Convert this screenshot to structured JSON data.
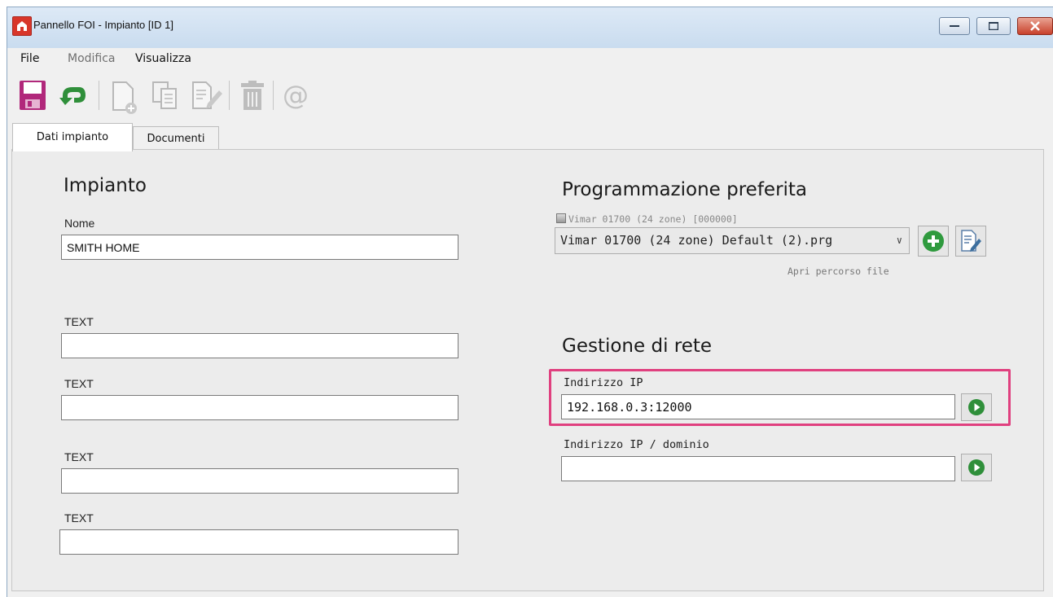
{
  "window": {
    "title": "Pannello FOI - Impianto [ID 1]",
    "controls": [
      "minimize",
      "maximize",
      "close"
    ]
  },
  "menu": [
    {
      "label": "File",
      "enabled": true
    },
    {
      "label": "Modifica",
      "enabled": false
    },
    {
      "label": "Visualizza",
      "enabled": true
    }
  ],
  "toolbar": {
    "icons": [
      "save-icon",
      "undo-icon",
      "new-document-icon",
      "copy-document-icon",
      "edit-document-icon",
      "delete-icon",
      "email-icon"
    ]
  },
  "tabs": [
    {
      "label": "Dati impianto",
      "active": true
    },
    {
      "label": "Documenti",
      "active": false
    }
  ],
  "impianto": {
    "heading": "Impianto",
    "nome_label": "Nome",
    "nome_value": "SMITH HOME",
    "text_fields": [
      {
        "label": "TEXT",
        "value": ""
      },
      {
        "label": "TEXT",
        "value": ""
      },
      {
        "label": "TEXT",
        "value": ""
      },
      {
        "label": "TEXT",
        "value": ""
      }
    ]
  },
  "programmazione": {
    "heading": "Programmazione preferita",
    "device_info": "Vimar 01700 (24 zone) [000000]",
    "selected_file": "Vimar 01700 (24 zone) Default (2).prg",
    "open_path_link": "Apri percorso file"
  },
  "rete": {
    "heading": "Gestione di rete",
    "ip_label": "Indirizzo IP",
    "ip_value": "192.168.0.3:12000",
    "domain_label": "Indirizzo IP / dominio",
    "domain_value": ""
  },
  "colors": {
    "highlight": "#e0407f",
    "accent_green": "#2f8f3a",
    "title_bar": "#c9dcef"
  }
}
